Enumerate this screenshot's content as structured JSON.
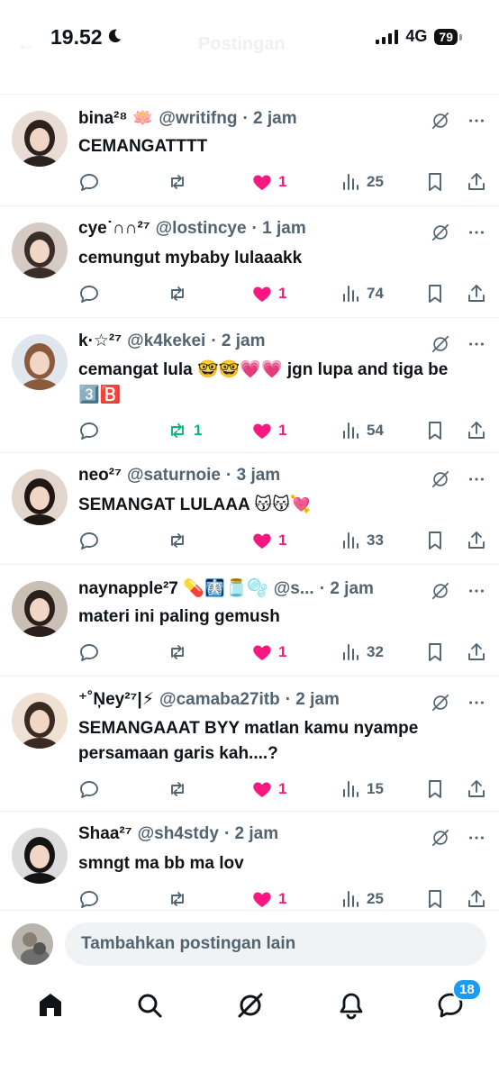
{
  "status": {
    "time": "19.52",
    "network": "4G",
    "battery": "79"
  },
  "header": {
    "title": "Postingan"
  },
  "posts": [
    {
      "name": "bina²⁸ 🪷",
      "handle": "@writifng",
      "time": "· 2 jam",
      "text": "CEMANGATTTT",
      "likes": "1",
      "views": "25",
      "reposts": ""
    },
    {
      "name": "cye˙∩∩²⁷",
      "handle": "@lostincye",
      "time": "· 1 jam",
      "text": "cemungut mybaby lulaaakk",
      "likes": "1",
      "views": "74",
      "reposts": ""
    },
    {
      "name": "k·☆²⁷",
      "handle": "@k4kekei",
      "time": "· 2 jam",
      "text": "cemangat lula 🤓🤓💗💗 jgn lupa and tiga be 3️⃣🅱️",
      "likes": "1",
      "views": "54",
      "reposts": "1"
    },
    {
      "name": "neo²⁷",
      "handle": "@saturnoie",
      "time": "· 3 jam",
      "text": "SEMANGAT LULAAA 😽😽💘",
      "likes": "1",
      "views": "33",
      "reposts": ""
    },
    {
      "name": "naynapple²7 💊🩻🫙🫧",
      "handle": "@s...",
      "time": "· 2 jam",
      "text": "materi ini paling gemush",
      "likes": "1",
      "views": "32",
      "reposts": ""
    },
    {
      "name": "⁺˚Ņey²⁷|⚡",
      "handle": "@camaba27itb",
      "time": "· 2 jam",
      "text": "SEMANGAAAT BYY matlan kamu nyampe persamaan garis kah....?",
      "likes": "1",
      "views": "15",
      "reposts": ""
    },
    {
      "name": "Shaa²⁷",
      "handle": "@sh4stdy",
      "time": "· 2 jam",
      "text": "smngt ma bb ma lov",
      "likes": "1",
      "views": "25",
      "reposts": ""
    }
  ],
  "compose": {
    "placeholder": "Tambahkan postingan lain"
  },
  "tabs": {
    "notifications_badge": "18"
  },
  "colors": {
    "like": "#f91880",
    "repost_active": "#00ba7c",
    "secondary_text": "#536471",
    "badge": "#1d9bf0"
  },
  "icons": [
    "reply-icon",
    "repost-icon",
    "heart-icon",
    "views-icon",
    "bookmark-icon",
    "share-icon",
    "grok-icon",
    "more-icon",
    "home-icon",
    "search-icon",
    "notifications-icon",
    "messages-icon"
  ]
}
